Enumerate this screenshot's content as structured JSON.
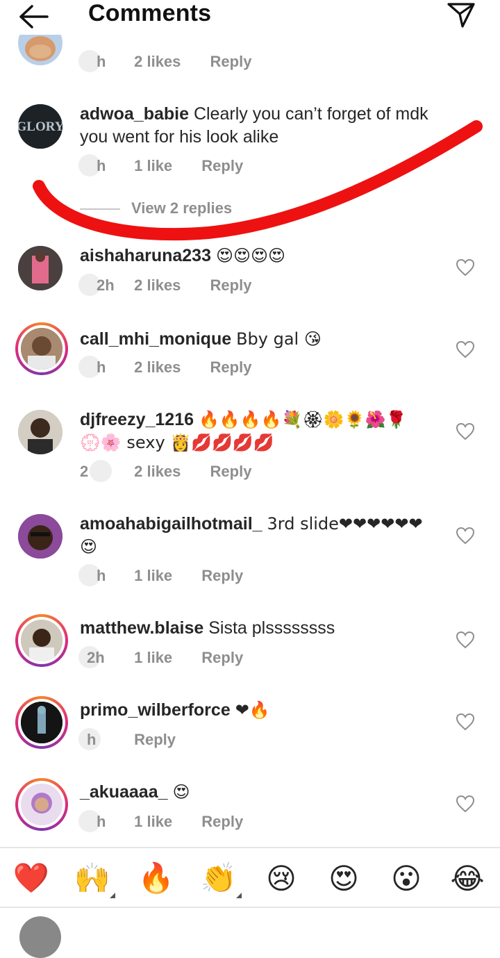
{
  "header": {
    "title": "Comments"
  },
  "comments": [
    {
      "username": "",
      "text": "",
      "time": "h",
      "likes": "2 likes",
      "reply": "Reply"
    },
    {
      "username": "adwoa_babie",
      "text": "Clearly you can’t forget of mdk you went for his look alike",
      "time": "h",
      "likes": "1 like",
      "reply": "Reply",
      "view_replies": "View 2 replies",
      "avatar_text": "GLORY"
    },
    {
      "username": "aishaharuna233",
      "text": "😍😍😍😍",
      "time": "2h",
      "likes": "2 likes",
      "reply": "Reply"
    },
    {
      "username": "call_mhi_monique",
      "text": "Bby gal 😘",
      "time": "h",
      "likes": "2 likes",
      "reply": "Reply"
    },
    {
      "username": "djfreezy_1216",
      "text": "🔥🔥🔥🔥💐🏵🌼🌻🌺🌹💮🌸 sexy 👸💋💋💋💋",
      "time": "2",
      "likes": "2 likes",
      "reply": "Reply"
    },
    {
      "username": "amoahabigailhotmail_",
      "text": "3rd slide❤❤❤❤❤❤😍",
      "time": "h",
      "likes": "1 like",
      "reply": "Reply"
    },
    {
      "username": "matthew.blaise",
      "text": "Sista plssssssss",
      "time": "2h",
      "likes": "1 like",
      "reply": "Reply"
    },
    {
      "username": "primo_wilberforce",
      "text": "❤🔥",
      "time": "h",
      "likes": "",
      "reply": "Reply"
    },
    {
      "username": "_akuaaaa_",
      "text": "😍",
      "time": "h",
      "likes": "1 like",
      "reply": "Reply"
    }
  ],
  "emoji_bar": [
    "❤️",
    "🙌",
    "🔥",
    "👏",
    "😢",
    "😍",
    "😮",
    "😂"
  ],
  "colors": {
    "text": "#262626",
    "meta": "#8e8e8e",
    "heart_red": "#ed4956",
    "scribble": "#ee1111",
    "story_ring": "#dd2a7b"
  }
}
